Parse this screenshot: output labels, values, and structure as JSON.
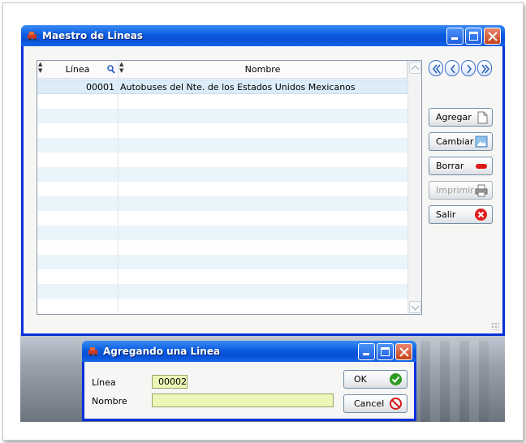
{
  "main_window": {
    "title": "Maestro de Lineas",
    "grid": {
      "columns": [
        "Línea",
        "Nombre"
      ],
      "rows": [
        {
          "linea": "00001",
          "nombre": "Autobuses del Nte. de los Estados Unidos Mexicanos"
        }
      ],
      "empty_rows": 15
    },
    "nav_icons": [
      "first-page-icon",
      "previous-icon",
      "next-icon",
      "last-page-icon"
    ],
    "buttons": {
      "agregar": "Agregar",
      "cambiar": "Cambiar",
      "borrar": "Borrar",
      "imprimir": "Imprimir",
      "salir": "Salir"
    }
  },
  "dialog": {
    "title": "Agregando una Linea",
    "linea_label": "Línea",
    "linea_value": "00002",
    "nombre_label": "Nombre",
    "nombre_value": "",
    "ok_label": "OK",
    "cancel_label": "Cancel"
  },
  "colors": {
    "titlebar": "#0a5ce0",
    "selected_row": "#dcecf8",
    "input_fill": "#eaf7b7",
    "ok_green": "#2e9b1f",
    "cancel_red": "#d41a1a"
  }
}
